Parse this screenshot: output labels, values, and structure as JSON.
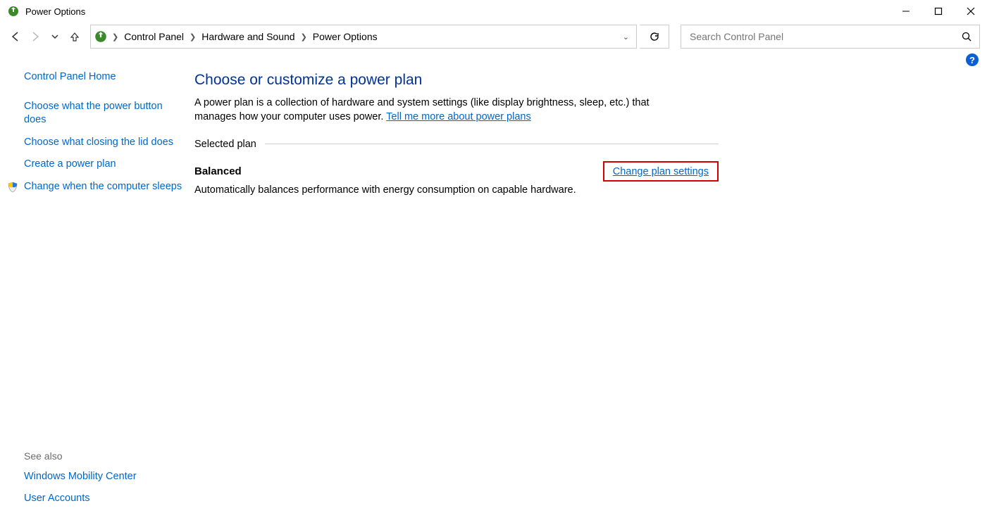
{
  "window": {
    "title": "Power Options"
  },
  "breadcrumb": {
    "items": [
      "Control Panel",
      "Hardware and Sound",
      "Power Options"
    ]
  },
  "search": {
    "placeholder": "Search Control Panel"
  },
  "sidebar": {
    "home": "Control Panel Home",
    "links": [
      "Choose what the power button does",
      "Choose what closing the lid does",
      "Create a power plan",
      "Change when the computer sleeps"
    ],
    "see_also_label": "See also",
    "see_also": [
      "Windows Mobility Center",
      "User Accounts"
    ]
  },
  "main": {
    "heading": "Choose or customize a power plan",
    "description_pre": "A power plan is a collection of hardware and system settings (like display brightness, sleep, etc.) that manages how your computer uses power. ",
    "description_link": "Tell me more about power plans",
    "section_label": "Selected plan",
    "plan": {
      "name": "Balanced",
      "change_link": "Change plan settings",
      "description": "Automatically balances performance with energy consumption on capable hardware."
    }
  }
}
